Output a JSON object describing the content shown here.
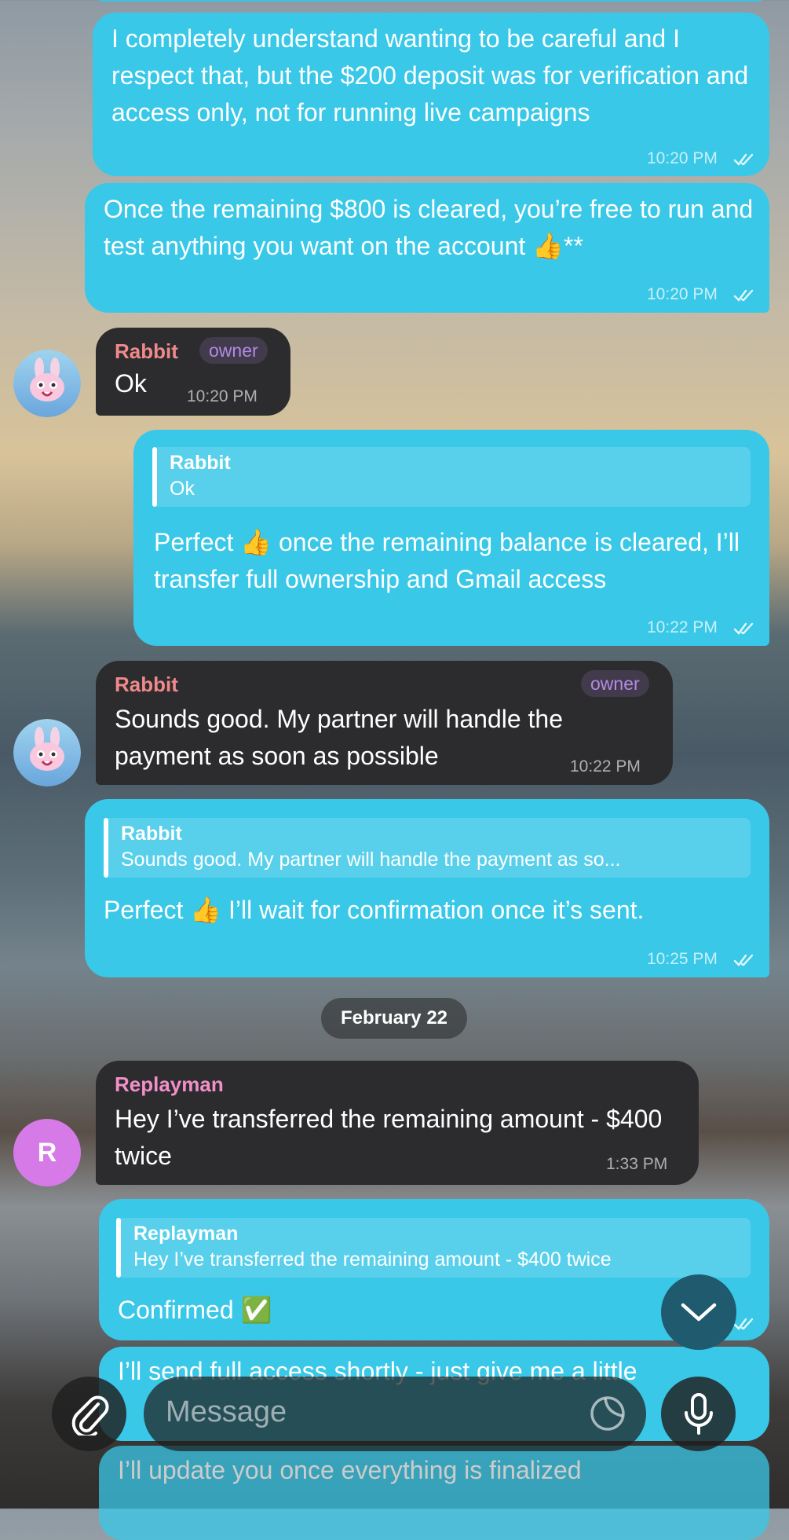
{
  "date_separator": "February 22",
  "messages": {
    "m1": {
      "text": "I completely understand wanting to be careful and I respect that, but the $200 deposit was for verification and access only, not for running live campaigns",
      "time": "10:20 PM"
    },
    "m2": {
      "text": "Once the remaining $800 is cleared, you’re free to run and test anything you want on the account 👍**",
      "time": "10:20 PM"
    },
    "m3": {
      "sender": "Rabbit",
      "role": "owner",
      "text": "Ok",
      "time": "10:20 PM"
    },
    "m4": {
      "quote_sender": "Rabbit",
      "quote_text": "Ok",
      "text": "Perfect 👍 once the remaining balance is cleared, I’ll transfer full ownership and Gmail access",
      "time": "10:22 PM"
    },
    "m5": {
      "sender": "Rabbit",
      "role": "owner",
      "text": "Sounds good. My partner will handle the payment as soon as possible",
      "time": "10:22 PM"
    },
    "m6": {
      "quote_sender": "Rabbit",
      "quote_text": "Sounds good. My partner will handle the payment as so...",
      "text": "Perfect 👍 I’ll wait for confirmation once it’s sent.",
      "time": "10:25 PM"
    },
    "m7": {
      "sender": "Replayman",
      "avatar_letter": "R",
      "text": "Hey I’ve transferred the remaining amount - $400 twice",
      "time": "1:33 PM"
    },
    "m8": {
      "quote_sender": "Replayman",
      "quote_text": "Hey I’ve transferred the remaining amount - $400 twice",
      "text": "Confirmed ✅"
    },
    "m9": {
      "text": "I’ll send full access shortly - just give me a little"
    },
    "m10": {
      "text": "I’ll update you once everything is finalized"
    }
  },
  "composer": {
    "placeholder": "Message"
  },
  "icons": {
    "attach": "paperclip-icon",
    "sticker": "sticker-icon",
    "mic": "microphone-icon",
    "scroll_down": "chevron-down-icon",
    "read": "double-check-icon"
  },
  "colors": {
    "outgoing_bubble": "#39c8e8",
    "incoming_bubble": "#2c2c2e",
    "rabbit_name": "#f08a8a",
    "replayman_name": "#f28fc9",
    "owner_tag": "#b48ae6",
    "replayman_avatar": "#d67ae8"
  }
}
